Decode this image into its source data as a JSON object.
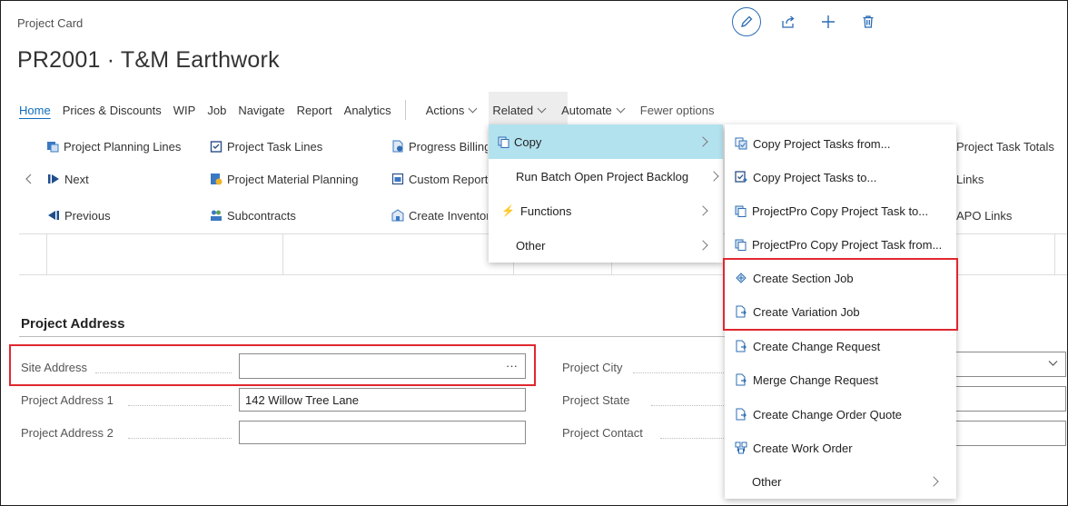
{
  "header": {
    "caption": "Project Card",
    "title": "PR2001 · T&M Earthwork"
  },
  "tabs": [
    {
      "label": "Home"
    },
    {
      "label": "Prices & Discounts"
    },
    {
      "label": "WIP"
    },
    {
      "label": "Job"
    },
    {
      "label": "Navigate"
    },
    {
      "label": "Report"
    },
    {
      "label": "Analytics"
    },
    {
      "label": "Actions"
    },
    {
      "label": "Related"
    },
    {
      "label": "Automate"
    },
    {
      "label": "Fewer options"
    }
  ],
  "actions": {
    "planning_lines": "Project Planning Lines",
    "next": "Next",
    "previous": "Previous",
    "task_lines": "Project Task Lines",
    "material_planning": "Project Material Planning",
    "subcontracts": "Subcontracts",
    "progress_billing": "Progress Billing",
    "custom_report": "Custom Report",
    "create_inventory": "Create Inventory",
    "task_totals": "Project Task Totals",
    "links": "Links",
    "apo_links": "APO Links"
  },
  "actions_menu": [
    {
      "label": "Copy",
      "submenu": true
    },
    {
      "label": "Run Batch Open Project Backlog",
      "submenu": true
    },
    {
      "label": "Functions",
      "submenu": true
    },
    {
      "label": "Other",
      "submenu": true
    }
  ],
  "copy_submenu": [
    {
      "label": "Copy Project Tasks from..."
    },
    {
      "label": "Copy Project Tasks to..."
    },
    {
      "label": "ProjectPro Copy Project Task to..."
    },
    {
      "label": "ProjectPro Copy Project Task from..."
    },
    {
      "label": "Create Section Job"
    },
    {
      "label": "Create Variation Job"
    },
    {
      "label": "Create Change Request"
    },
    {
      "label": "Merge Change Request"
    },
    {
      "label": "Create Change Order Quote"
    },
    {
      "label": "Create Work Order"
    },
    {
      "label": "Other"
    }
  ],
  "address": {
    "section_title": "Project Address",
    "site_address_label": "Site Address",
    "site_address_value": "",
    "lookup": "···",
    "address1_label": "Project Address 1",
    "address1_value": "142 Willow Tree Lane",
    "address2_label": "Project Address 2",
    "address2_value": "",
    "city_label": "Project City",
    "state_label": "Project State",
    "contact_label": "Project Contact"
  },
  "colors": {
    "accent": "#0f6cbd",
    "highlight": "#b3e2ef",
    "callout": "#e0272f"
  }
}
